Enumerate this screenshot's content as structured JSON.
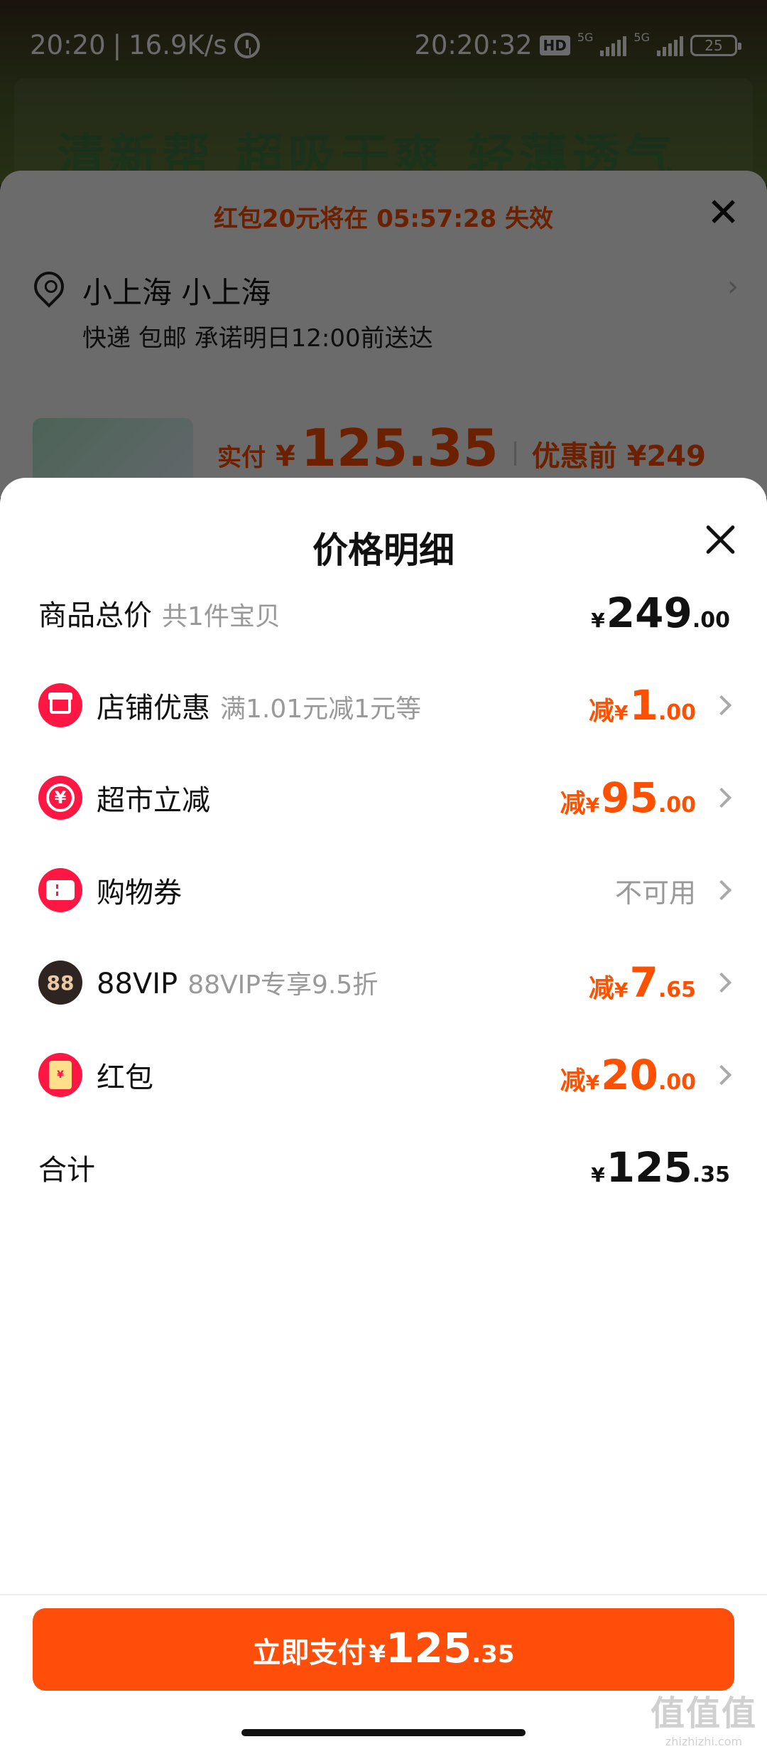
{
  "status_bar": {
    "time": "20:20",
    "speed": "16.9K/s",
    "clock": "20:20:32",
    "hd": "HD",
    "net1": "5G",
    "net2": "5G",
    "battery": "25"
  },
  "background": {
    "banner_text": "清新帮 超吸干爽 轻薄透气",
    "countdown": "红包20元将在 05:57:28 失效",
    "address": "小上海 小上海",
    "delivery": "快递 包邮 承诺明日12:00前送达",
    "paid_label": "实付",
    "paid_yen": "¥",
    "paid_amount": "125.35",
    "pre_price": "优惠前 ¥249"
  },
  "sheet": {
    "title": "价格明细",
    "rows": [
      {
        "label": "商品总价",
        "sub": "共1件宝贝",
        "prefix": "",
        "yen": "¥",
        "int": "249",
        "dec": ".00",
        "icon": ""
      },
      {
        "label": "店铺优惠",
        "sub": "满1.01元减1元等",
        "prefix": "减",
        "yen": "¥",
        "int": "1",
        "dec": ".00",
        "icon": "store-icon"
      },
      {
        "label": "超市立减",
        "sub": "",
        "prefix": "减",
        "yen": "¥",
        "int": "95",
        "dec": ".00",
        "icon": "yen-coin-icon"
      },
      {
        "label": "购物券",
        "sub": "",
        "status": "不可用",
        "icon": "ticket-icon"
      },
      {
        "label": "88VIP",
        "sub": "88VIP专享9.5折",
        "prefix": "减",
        "yen": "¥",
        "int": "7",
        "dec": ".65",
        "icon": "vip-88-icon",
        "icon_text": "88"
      },
      {
        "label": "红包",
        "sub": "",
        "prefix": "减",
        "yen": "¥",
        "int": "20",
        "dec": ".00",
        "icon": "red-envelope-icon",
        "icon_text": "¥"
      }
    ],
    "total": {
      "label": "合计",
      "yen": "¥",
      "int": "125",
      "dec": ".35"
    }
  },
  "footer": {
    "pay_label": "立即支付",
    "pay_yen": "¥",
    "pay_int": "125",
    "pay_dec": ".35"
  },
  "watermark": {
    "logo": "值值值",
    "url": "zhizhizhi.com"
  },
  "colors": {
    "accent": "#ff5000",
    "icon_red": "#ff1744",
    "pay_button": "#ff4e0a"
  }
}
